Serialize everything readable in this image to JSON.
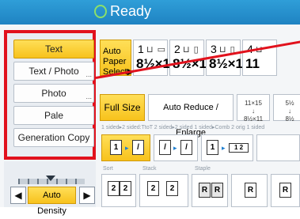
{
  "header": {
    "status": "Ready"
  },
  "modes": [
    "Text",
    "Text / Photo",
    "Photo",
    "Pale",
    "Generation Copy"
  ],
  "density": {
    "label": "Auto Density",
    "left": "◀",
    "right": "▶",
    "level": 0.5
  },
  "paper": {
    "auto_label": "Auto Paper Select▶",
    "trays": [
      {
        "num": "1",
        "icons": "⊔ ▭",
        "size": "8½×11"
      },
      {
        "num": "2",
        "icons": "⊔ ▯",
        "size": "8½×11"
      },
      {
        "num": "3",
        "icons": "⊔ ▯",
        "size": "8½×11"
      },
      {
        "num": "4",
        "icons": "⊔",
        "size": "11"
      }
    ]
  },
  "reduce": {
    "full_size": "Full Size",
    "auto_reduce": "Auto Reduce / Enlarge",
    "ratio1_line1": "11×15",
    "ratio1_line2": "8½×11",
    "ratio2_line1": "5½",
    "ratio2_line2": "8½"
  },
  "duplex": {
    "labels": "1 sided▸2 sided:TtoT   2 sided▸2 sided   1 sided▸Comb 2 orig 1 sided"
  },
  "finishing": {
    "sort": "Sort",
    "stack": "Stack",
    "staple": "Staple"
  },
  "colors": {
    "selected": "#f7c21c",
    "header": "#1f83c2",
    "highlight_frame": "#e1121d"
  }
}
